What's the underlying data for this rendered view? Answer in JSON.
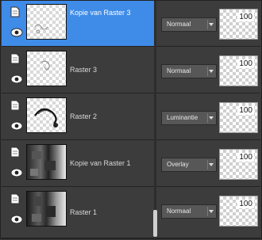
{
  "layers": [
    {
      "name": "Kopie van Raster 3",
      "blend_mode": "Normaal",
      "opacity": "100",
      "selected": true,
      "thumb": "transparent-sketch"
    },
    {
      "name": "Raster 3",
      "blend_mode": "Normaal",
      "opacity": "100",
      "selected": false,
      "thumb": "transparent-sketch"
    },
    {
      "name": "Raster 2",
      "blend_mode": "Luminantie",
      "opacity": "100",
      "selected": false,
      "thumb": "ring-drawing"
    },
    {
      "name": "Kopie van Raster 1",
      "blend_mode": "Overlay",
      "opacity": "100",
      "selected": false,
      "thumb": "dark-image"
    },
    {
      "name": "Raster 1",
      "blend_mode": "Normaal",
      "opacity": "100",
      "selected": false,
      "thumb": "dark-image"
    }
  ],
  "icons": {
    "layer": "layer-doc-icon",
    "visibility": "eye-icon",
    "dropdown": "chevron-down-icon"
  },
  "colors": {
    "selected": "#3f8be8",
    "panel": "#3c3c3c"
  }
}
